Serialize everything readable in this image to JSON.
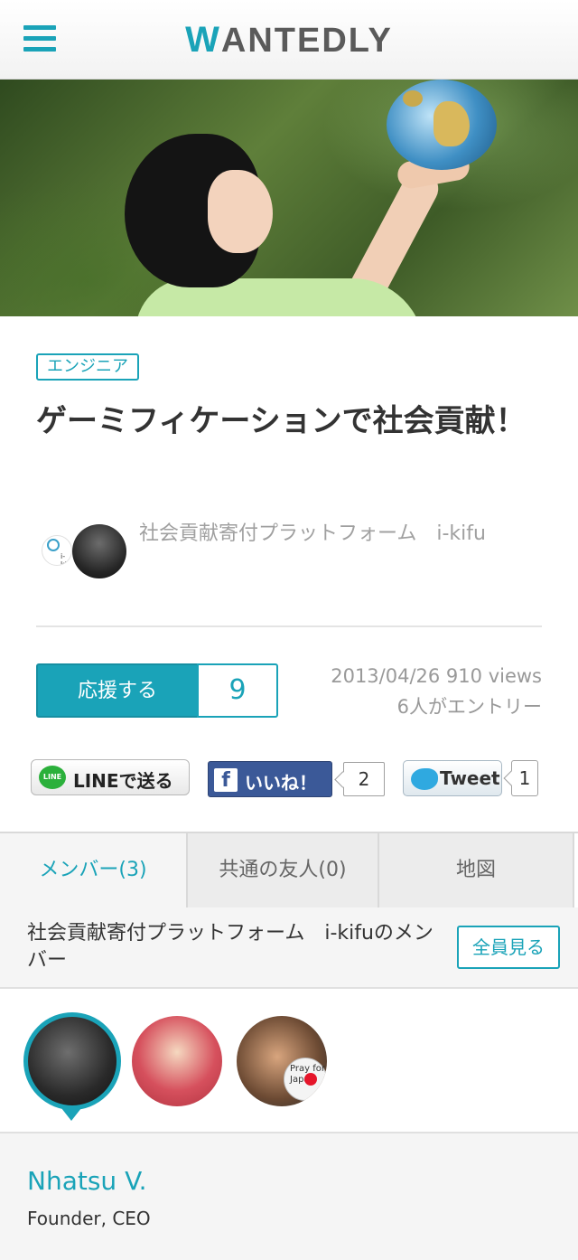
{
  "header": {
    "logo_first": "W",
    "logo_rest": "ANTEDLY",
    "menu_icon": "hamburger-menu-icon",
    "accent_color": "#1aa3b8"
  },
  "hero": {
    "description_icon": "hero-image"
  },
  "job": {
    "tag": "エンジニア",
    "title": "ゲーミフィケーションで社会貢献！",
    "company_logo_text": "i-kifu",
    "company_name": "社会貢献寄付プラットフォーム　i-kifu"
  },
  "support": {
    "button_label": "応援する",
    "count": "9",
    "date_views": "2013/04/26 910 views",
    "entries": "6人がエントリー"
  },
  "social": {
    "line_icon_text": "LINE",
    "line_label": "LINEで送る",
    "fb_icon_text": "f",
    "fb_label": "いいね！",
    "fb_count": "2",
    "tweet_label": "Tweet",
    "tweet_count": "1"
  },
  "tabs": [
    {
      "label": "メンバー(3)",
      "active": true
    },
    {
      "label": "共通の友人(0)",
      "active": false
    },
    {
      "label": "地図",
      "active": false
    }
  ],
  "members": {
    "label": "社会貢献寄付プラットフォーム　i-kifuのメンバー",
    "see_all": "全員見る",
    "badge_text": "Pray for Japan"
  },
  "profile": {
    "name": "Nhatsu V.",
    "role": "Founder, CEO"
  }
}
